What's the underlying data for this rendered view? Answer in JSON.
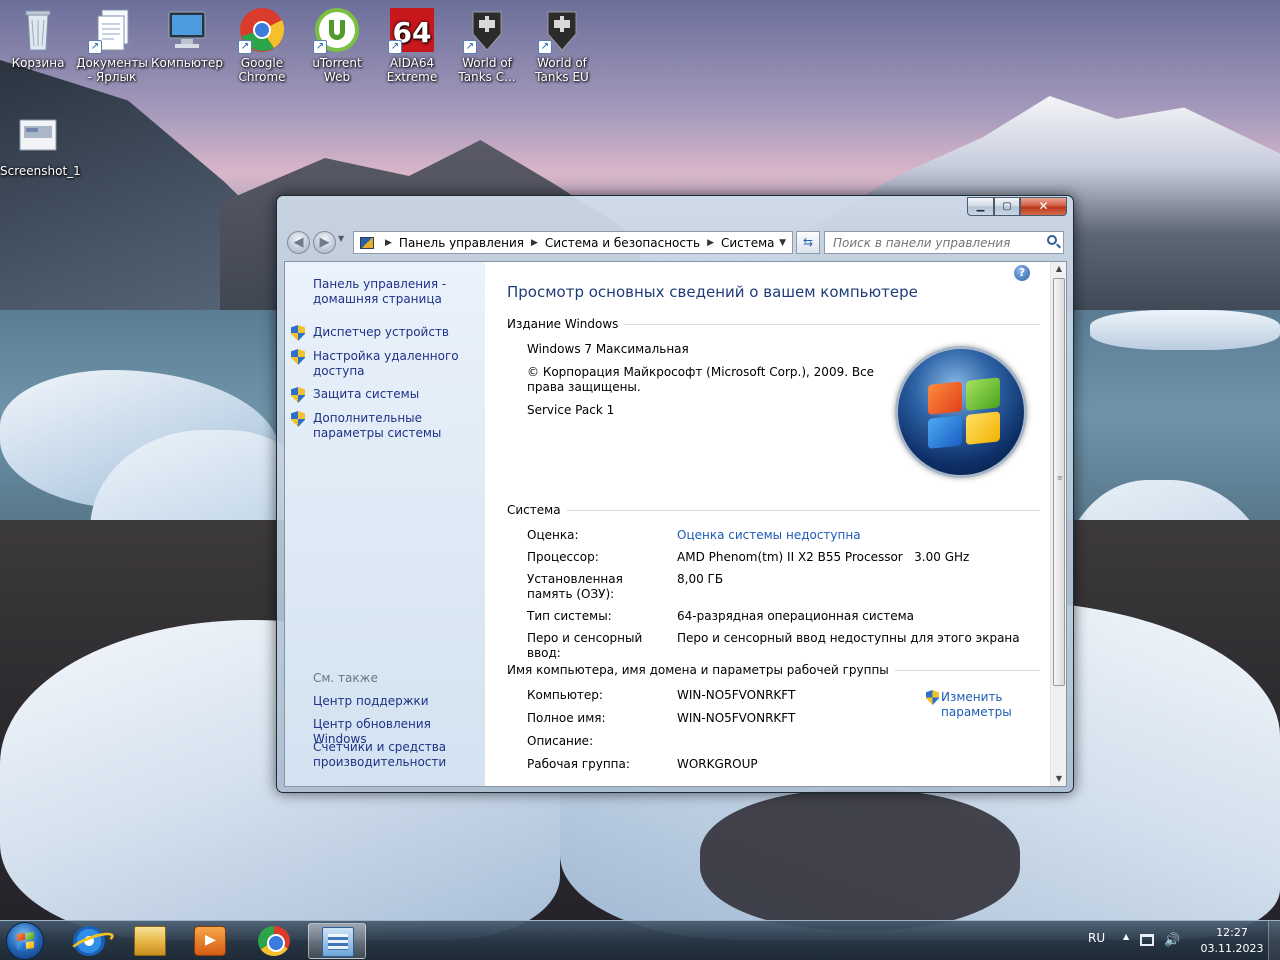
{
  "desktop": {
    "icons": [
      {
        "label": "Корзина",
        "icon": "recycle-bin-icon"
      },
      {
        "label": "Документы - Ярлык",
        "icon": "documents-icon"
      },
      {
        "label": "Компьютер",
        "icon": "computer-icon"
      },
      {
        "label": "Google Chrome",
        "icon": "chrome-icon"
      },
      {
        "label": "uTorrent Web",
        "icon": "utorrent-icon"
      },
      {
        "label": "AIDA64 Extreme",
        "icon": "aida64-icon"
      },
      {
        "label": "World of Tanks C...",
        "icon": "world-of-tanks-icon"
      },
      {
        "label": "World of Tanks EU",
        "icon": "world-of-tanks-icon"
      },
      {
        "label": "Screenshot_1",
        "icon": "screenshot-file-icon"
      }
    ],
    "aida_text": "64"
  },
  "window": {
    "buttons": {
      "minimize": "▁",
      "maximize": "▢",
      "close": "✕"
    },
    "address": {
      "crumbs": [
        "Панель управления",
        "Система и безопасность",
        "Система"
      ]
    },
    "search": {
      "placeholder": "Поиск в панели управления"
    },
    "sidebar": {
      "home": "Панель управления - домашняя страница",
      "tasks": [
        "Диспетчер устройств",
        "Настройка удаленного доступа",
        "Защита системы",
        "Дополнительные параметры системы"
      ],
      "see_also_title": "См. также",
      "see_also": [
        "Центр поддержки",
        "Центр обновления Windows",
        "Счетчики и средства производительности"
      ]
    },
    "content": {
      "title": "Просмотр основных сведений о вашем компьютере",
      "edition": {
        "header": "Издание Windows",
        "name": "Windows 7 Максимальная",
        "copyright": "© Корпорация Майкрософт (Microsoft Corp.), 2009. Все права защищены.",
        "service_pack": "Service Pack 1"
      },
      "system": {
        "header": "Система",
        "rows": [
          {
            "label": "Оценка:",
            "value": "Оценка системы недоступна",
            "link": true
          },
          {
            "label": "Процессор:",
            "value": "AMD Phenom(tm) II X2 B55 Processor   3.00 GHz"
          },
          {
            "label": "Установленная память (ОЗУ):",
            "value": "8,00 ГБ"
          },
          {
            "label": "Тип системы:",
            "value": "64-разрядная операционная система"
          },
          {
            "label": "Перо и сенсорный ввод:",
            "value": "Перо и сенсорный ввод недоступны для этого экрана"
          }
        ]
      },
      "computer": {
        "header": "Имя компьютера, имя домена и параметры рабочей группы",
        "rows": [
          {
            "label": "Компьютер:",
            "value": "WIN-NO5FVONRKFT"
          },
          {
            "label": "Полное имя:",
            "value": "WIN-NO5FVONRKFT"
          },
          {
            "label": "Описание:",
            "value": ""
          },
          {
            "label": "Рабочая группа:",
            "value": "WORKGROUP"
          }
        ],
        "change_link": "Изменить параметры"
      }
    }
  },
  "taskbar": {
    "pinned": [
      "internet-explorer-icon",
      "explorer-icon",
      "media-player-icon",
      "chrome-icon",
      "control-panel-icon"
    ],
    "language": "RU",
    "time": "12:27",
    "date": "03.11.2023"
  }
}
